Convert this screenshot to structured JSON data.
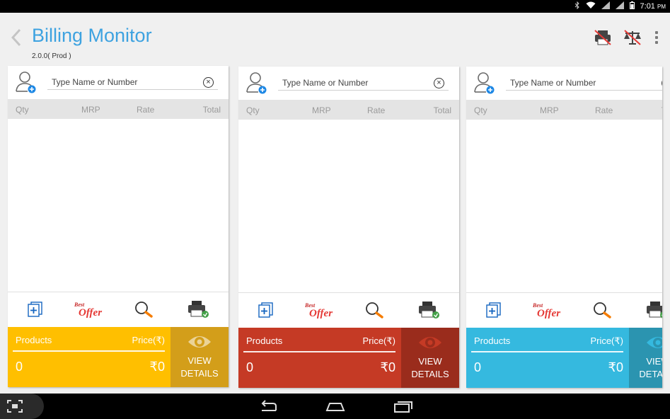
{
  "status_bar": {
    "time": "7:01",
    "ampm": "PM",
    "icons": [
      "bluetooth-icon",
      "wifi-icon",
      "signal-icon",
      "signal-icon",
      "battery-icon"
    ]
  },
  "app": {
    "title": "Billing Monitor",
    "version": "2.0.0( Prod )",
    "actions": [
      "printer-disabled-icon",
      "scale-disabled-icon",
      "overflow-menu-icon"
    ]
  },
  "panel_common": {
    "search_placeholder": "Type Name or Number",
    "columns": {
      "qty": "Qty",
      "mrp": "MRP",
      "rate": "Rate",
      "total": "Total"
    },
    "tools": [
      "add-item-icon",
      "best-offer-icon",
      "search-icon",
      "print-icon"
    ],
    "offer_text_top": "Best",
    "offer_text_bottom": "Offer",
    "products_label": "Products",
    "price_label": "Price(₹)",
    "view_details_line1": "VIEW",
    "view_details_line2": "DETAILS"
  },
  "panels": [
    {
      "products_count": "0",
      "price_total": "₹0",
      "color_main": "#ffbf00",
      "color_dark": "#d39e1a"
    },
    {
      "products_count": "0",
      "price_total": "₹0",
      "color_main": "#c53a25",
      "color_dark": "#9a2c1c"
    },
    {
      "products_count": "0",
      "price_total": "₹0",
      "color_main": "#35b9df",
      "color_dark": "#2b94b0"
    }
  ],
  "nav_bar": {
    "buttons": [
      "back-nav-icon",
      "home-nav-icon",
      "recent-apps-icon"
    ],
    "left_icon": "screenshot-icon"
  }
}
